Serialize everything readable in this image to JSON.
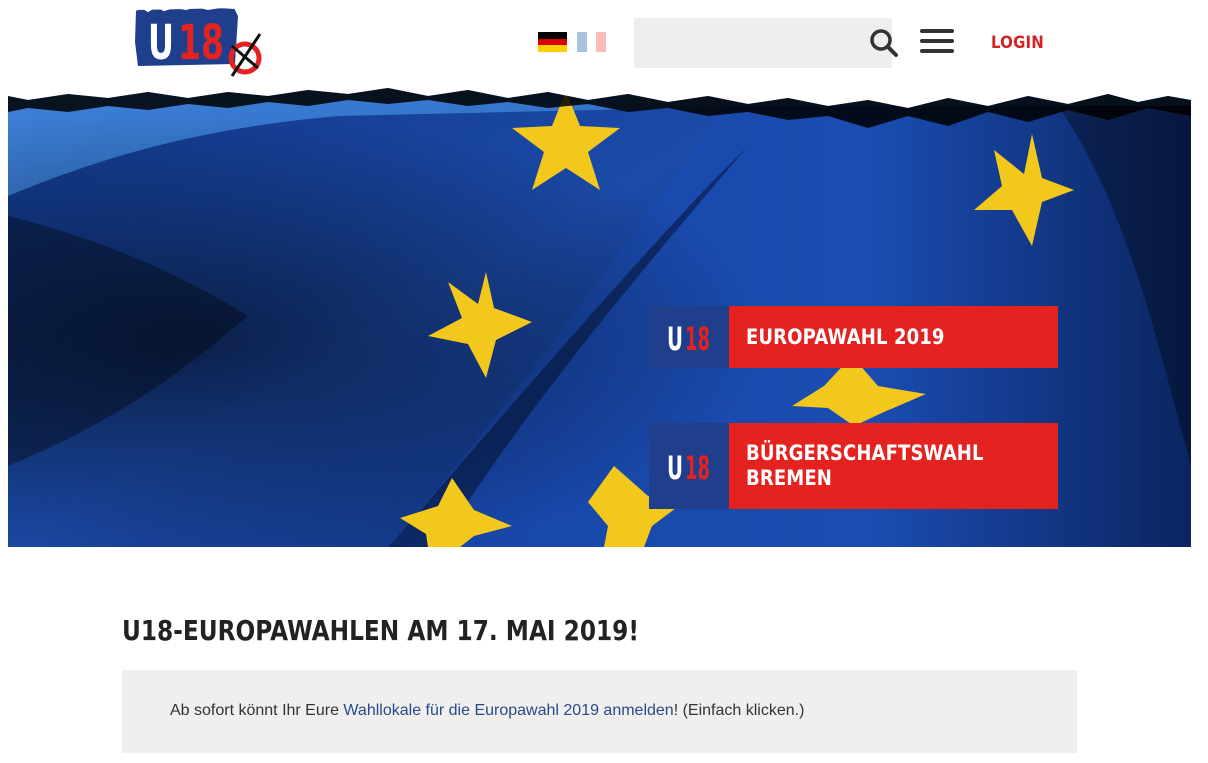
{
  "header": {
    "logo_text": "U18",
    "languages": [
      "Deutsch",
      "Français"
    ],
    "search_placeholder": "",
    "login_label": "LOGIN"
  },
  "hero": {
    "cards": [
      {
        "badge": "U18",
        "label": "EUROPAWAHL 2019"
      },
      {
        "badge": "U18",
        "label": "BÜRGERSCHAFTSWAHL\nBREMEN"
      }
    ]
  },
  "main": {
    "headline": "U18-EUROPAWAHLEN AM 17. MAI 2019!",
    "notice": {
      "prefix": "Ab sofort könnt Ihr Eure ",
      "link": "Wahllokale für die Europawahl 2019 anmelden",
      "suffix": "! (Einfach klicken.)"
    }
  },
  "colors": {
    "brand_red": "#e42320",
    "brand_blue": "#1f3e8c",
    "login_red": "#d32424",
    "eu_blue": "#143d9c",
    "star_yellow": "#f2c81c"
  }
}
